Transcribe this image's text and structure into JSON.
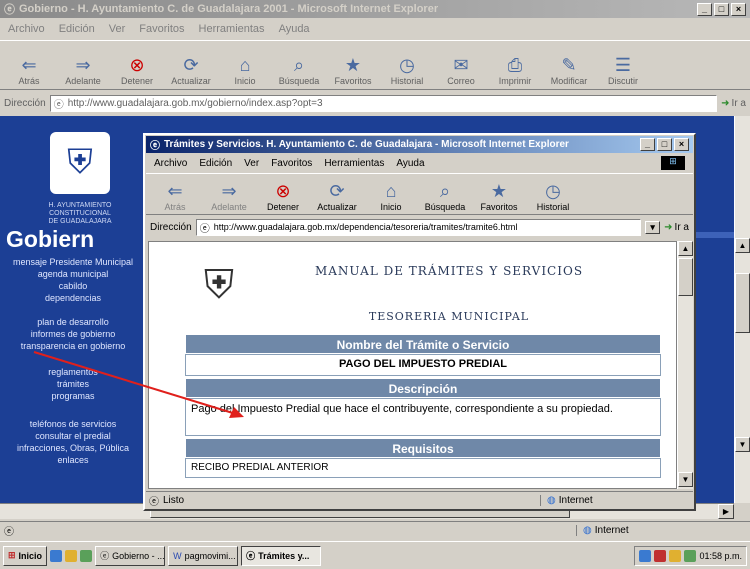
{
  "bg_window": {
    "title": "Gobierno - H. Ayuntamiento C. de Guadalajara 2001 - Microsoft Internet Explorer",
    "menu": [
      "Archivo",
      "Edición",
      "Ver",
      "Favoritos",
      "Herramientas",
      "Ayuda"
    ],
    "toolbar": [
      "Atrás",
      "Adelante",
      "Detener",
      "Actualizar",
      "Inicio",
      "Búsqueda",
      "Favoritos",
      "Historial",
      "Correo",
      "Imprimir",
      "Modificar",
      "Discutir"
    ],
    "address_label": "Dirección",
    "url": "http://www.guadalajara.gob.mx/gobierno/index.asp?opt=3",
    "go": "Ir a",
    "heading": "Gobiern",
    "org_lines": [
      "H. AYUNTAMIENTO",
      "CONSTITUCIONAL",
      "DE GUADALAJARA"
    ],
    "nav": [
      "mensaje Presidente Municipal",
      "agenda municipal",
      "cabildo",
      "dependencias",
      "plan de desarrollo",
      "informes de gobierno",
      "transparencia en gobierno",
      "reglamentos",
      "trámites",
      "programas",
      "teléfonos de servicios",
      "consultar el predial",
      "infracciones, Obras, Pública",
      "enlaces"
    ],
    "status": "",
    "status_zone": "Internet"
  },
  "fg_window": {
    "title": "Trámites y Servicios. H. Ayuntamiento C. de Guadalajara - Microsoft Internet Explorer",
    "menu": [
      "Archivo",
      "Edición",
      "Ver",
      "Favoritos",
      "Herramientas",
      "Ayuda"
    ],
    "toolbar": [
      "Atrás",
      "Adelante",
      "Detener",
      "Actualizar",
      "Inicio",
      "Búsqueda",
      "Favoritos",
      "Historial"
    ],
    "address_label": "Dirección",
    "url": "http://www.guadalajara.gob.mx/dependencia/tesoreria/tramites/tramite6.html",
    "go": "Ir a",
    "page_title": "MANUAL DE TRÁMITES Y SERVICIOS",
    "page_subtitle": "TESORERIA MUNICIPAL",
    "sections": [
      {
        "header": "Nombre del Trámite o Servicio",
        "value": "PAGO DEL IMPUESTO PREDIAL"
      },
      {
        "header": "Descripción",
        "value": "Pago del Impuesto Predial que hace el contribuyente, correspondiente a su propiedad."
      },
      {
        "header": "Requisitos",
        "value": "RECIBO PREDIAL ANTERIOR"
      }
    ],
    "status": "Listo",
    "status_zone": "Internet"
  },
  "taskbar": {
    "start": "Inicio",
    "tasks": [
      "Gobierno - ...",
      "pagmovimi...",
      "Trámites y..."
    ],
    "clock": "01:58 p.m."
  },
  "colors": {
    "title_active": "#0a246a",
    "site_blue": "#1c3f95",
    "section_header": "#6f88a8",
    "annotation_arrow": "#e0201c"
  }
}
